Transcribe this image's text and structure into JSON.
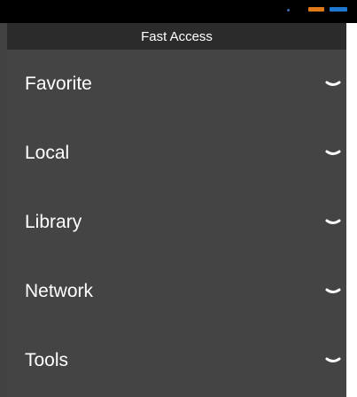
{
  "header": {
    "title": "Fast Access"
  },
  "sections": [
    {
      "label": "Favorite",
      "icon": "chevron-down-icon"
    },
    {
      "label": "Local",
      "icon": "chevron-down-icon"
    },
    {
      "label": "Library",
      "icon": "chevron-down-icon"
    },
    {
      "label": "Network",
      "icon": "chevron-down-icon"
    },
    {
      "label": "Tools",
      "icon": "chevron-down-icon"
    }
  ],
  "colors": {
    "background": "#424242",
    "header": "#2b2b2b",
    "status_bar": "#000000",
    "text": "#ffffff"
  }
}
